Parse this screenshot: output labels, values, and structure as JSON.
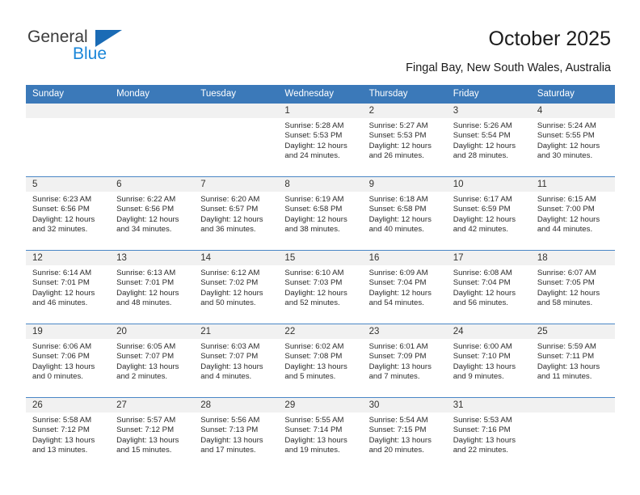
{
  "brand": {
    "name_part1": "General",
    "name_part2": "Blue",
    "triangle_color": "#1a6bb5",
    "blue_color": "#1a86d8"
  },
  "header": {
    "title": "October 2025",
    "subtitle": "Fingal Bay, New South Wales, Australia"
  },
  "theme": {
    "header_row_bg": "#3b79b9",
    "header_row_text": "#ffffff",
    "date_strip_bg": "#f1f1f1",
    "row_divider": "#4a86c6",
    "cell_bg": "#ffffff",
    "body_text": "#2b2b2b"
  },
  "weekday_headers": [
    "Sunday",
    "Monday",
    "Tuesday",
    "Wednesday",
    "Thursday",
    "Friday",
    "Saturday"
  ],
  "labels": {
    "sunrise": "Sunrise:",
    "sunset": "Sunset:",
    "daylight": "Daylight:"
  },
  "weeks": [
    [
      {
        "day": ""
      },
      {
        "day": ""
      },
      {
        "day": ""
      },
      {
        "day": "1",
        "sunrise": "Sunrise: 5:28 AM",
        "sunset": "Sunset: 5:53 PM",
        "daylight1": "Daylight: 12 hours",
        "daylight2": "and 24 minutes."
      },
      {
        "day": "2",
        "sunrise": "Sunrise: 5:27 AM",
        "sunset": "Sunset: 5:53 PM",
        "daylight1": "Daylight: 12 hours",
        "daylight2": "and 26 minutes."
      },
      {
        "day": "3",
        "sunrise": "Sunrise: 5:26 AM",
        "sunset": "Sunset: 5:54 PM",
        "daylight1": "Daylight: 12 hours",
        "daylight2": "and 28 minutes."
      },
      {
        "day": "4",
        "sunrise": "Sunrise: 5:24 AM",
        "sunset": "Sunset: 5:55 PM",
        "daylight1": "Daylight: 12 hours",
        "daylight2": "and 30 minutes."
      }
    ],
    [
      {
        "day": "5",
        "sunrise": "Sunrise: 6:23 AM",
        "sunset": "Sunset: 6:56 PM",
        "daylight1": "Daylight: 12 hours",
        "daylight2": "and 32 minutes."
      },
      {
        "day": "6",
        "sunrise": "Sunrise: 6:22 AM",
        "sunset": "Sunset: 6:56 PM",
        "daylight1": "Daylight: 12 hours",
        "daylight2": "and 34 minutes."
      },
      {
        "day": "7",
        "sunrise": "Sunrise: 6:20 AM",
        "sunset": "Sunset: 6:57 PM",
        "daylight1": "Daylight: 12 hours",
        "daylight2": "and 36 minutes."
      },
      {
        "day": "8",
        "sunrise": "Sunrise: 6:19 AM",
        "sunset": "Sunset: 6:58 PM",
        "daylight1": "Daylight: 12 hours",
        "daylight2": "and 38 minutes."
      },
      {
        "day": "9",
        "sunrise": "Sunrise: 6:18 AM",
        "sunset": "Sunset: 6:58 PM",
        "daylight1": "Daylight: 12 hours",
        "daylight2": "and 40 minutes."
      },
      {
        "day": "10",
        "sunrise": "Sunrise: 6:17 AM",
        "sunset": "Sunset: 6:59 PM",
        "daylight1": "Daylight: 12 hours",
        "daylight2": "and 42 minutes."
      },
      {
        "day": "11",
        "sunrise": "Sunrise: 6:15 AM",
        "sunset": "Sunset: 7:00 PM",
        "daylight1": "Daylight: 12 hours",
        "daylight2": "and 44 minutes."
      }
    ],
    [
      {
        "day": "12",
        "sunrise": "Sunrise: 6:14 AM",
        "sunset": "Sunset: 7:01 PM",
        "daylight1": "Daylight: 12 hours",
        "daylight2": "and 46 minutes."
      },
      {
        "day": "13",
        "sunrise": "Sunrise: 6:13 AM",
        "sunset": "Sunset: 7:01 PM",
        "daylight1": "Daylight: 12 hours",
        "daylight2": "and 48 minutes."
      },
      {
        "day": "14",
        "sunrise": "Sunrise: 6:12 AM",
        "sunset": "Sunset: 7:02 PM",
        "daylight1": "Daylight: 12 hours",
        "daylight2": "and 50 minutes."
      },
      {
        "day": "15",
        "sunrise": "Sunrise: 6:10 AM",
        "sunset": "Sunset: 7:03 PM",
        "daylight1": "Daylight: 12 hours",
        "daylight2": "and 52 minutes."
      },
      {
        "day": "16",
        "sunrise": "Sunrise: 6:09 AM",
        "sunset": "Sunset: 7:04 PM",
        "daylight1": "Daylight: 12 hours",
        "daylight2": "and 54 minutes."
      },
      {
        "day": "17",
        "sunrise": "Sunrise: 6:08 AM",
        "sunset": "Sunset: 7:04 PM",
        "daylight1": "Daylight: 12 hours",
        "daylight2": "and 56 minutes."
      },
      {
        "day": "18",
        "sunrise": "Sunrise: 6:07 AM",
        "sunset": "Sunset: 7:05 PM",
        "daylight1": "Daylight: 12 hours",
        "daylight2": "and 58 minutes."
      }
    ],
    [
      {
        "day": "19",
        "sunrise": "Sunrise: 6:06 AM",
        "sunset": "Sunset: 7:06 PM",
        "daylight1": "Daylight: 13 hours",
        "daylight2": "and 0 minutes."
      },
      {
        "day": "20",
        "sunrise": "Sunrise: 6:05 AM",
        "sunset": "Sunset: 7:07 PM",
        "daylight1": "Daylight: 13 hours",
        "daylight2": "and 2 minutes."
      },
      {
        "day": "21",
        "sunrise": "Sunrise: 6:03 AM",
        "sunset": "Sunset: 7:07 PM",
        "daylight1": "Daylight: 13 hours",
        "daylight2": "and 4 minutes."
      },
      {
        "day": "22",
        "sunrise": "Sunrise: 6:02 AM",
        "sunset": "Sunset: 7:08 PM",
        "daylight1": "Daylight: 13 hours",
        "daylight2": "and 5 minutes."
      },
      {
        "day": "23",
        "sunrise": "Sunrise: 6:01 AM",
        "sunset": "Sunset: 7:09 PM",
        "daylight1": "Daylight: 13 hours",
        "daylight2": "and 7 minutes."
      },
      {
        "day": "24",
        "sunrise": "Sunrise: 6:00 AM",
        "sunset": "Sunset: 7:10 PM",
        "daylight1": "Daylight: 13 hours",
        "daylight2": "and 9 minutes."
      },
      {
        "day": "25",
        "sunrise": "Sunrise: 5:59 AM",
        "sunset": "Sunset: 7:11 PM",
        "daylight1": "Daylight: 13 hours",
        "daylight2": "and 11 minutes."
      }
    ],
    [
      {
        "day": "26",
        "sunrise": "Sunrise: 5:58 AM",
        "sunset": "Sunset: 7:12 PM",
        "daylight1": "Daylight: 13 hours",
        "daylight2": "and 13 minutes."
      },
      {
        "day": "27",
        "sunrise": "Sunrise: 5:57 AM",
        "sunset": "Sunset: 7:12 PM",
        "daylight1": "Daylight: 13 hours",
        "daylight2": "and 15 minutes."
      },
      {
        "day": "28",
        "sunrise": "Sunrise: 5:56 AM",
        "sunset": "Sunset: 7:13 PM",
        "daylight1": "Daylight: 13 hours",
        "daylight2": "and 17 minutes."
      },
      {
        "day": "29",
        "sunrise": "Sunrise: 5:55 AM",
        "sunset": "Sunset: 7:14 PM",
        "daylight1": "Daylight: 13 hours",
        "daylight2": "and 19 minutes."
      },
      {
        "day": "30",
        "sunrise": "Sunrise: 5:54 AM",
        "sunset": "Sunset: 7:15 PM",
        "daylight1": "Daylight: 13 hours",
        "daylight2": "and 20 minutes."
      },
      {
        "day": "31",
        "sunrise": "Sunrise: 5:53 AM",
        "sunset": "Sunset: 7:16 PM",
        "daylight1": "Daylight: 13 hours",
        "daylight2": "and 22 minutes."
      },
      {
        "day": ""
      }
    ]
  ]
}
